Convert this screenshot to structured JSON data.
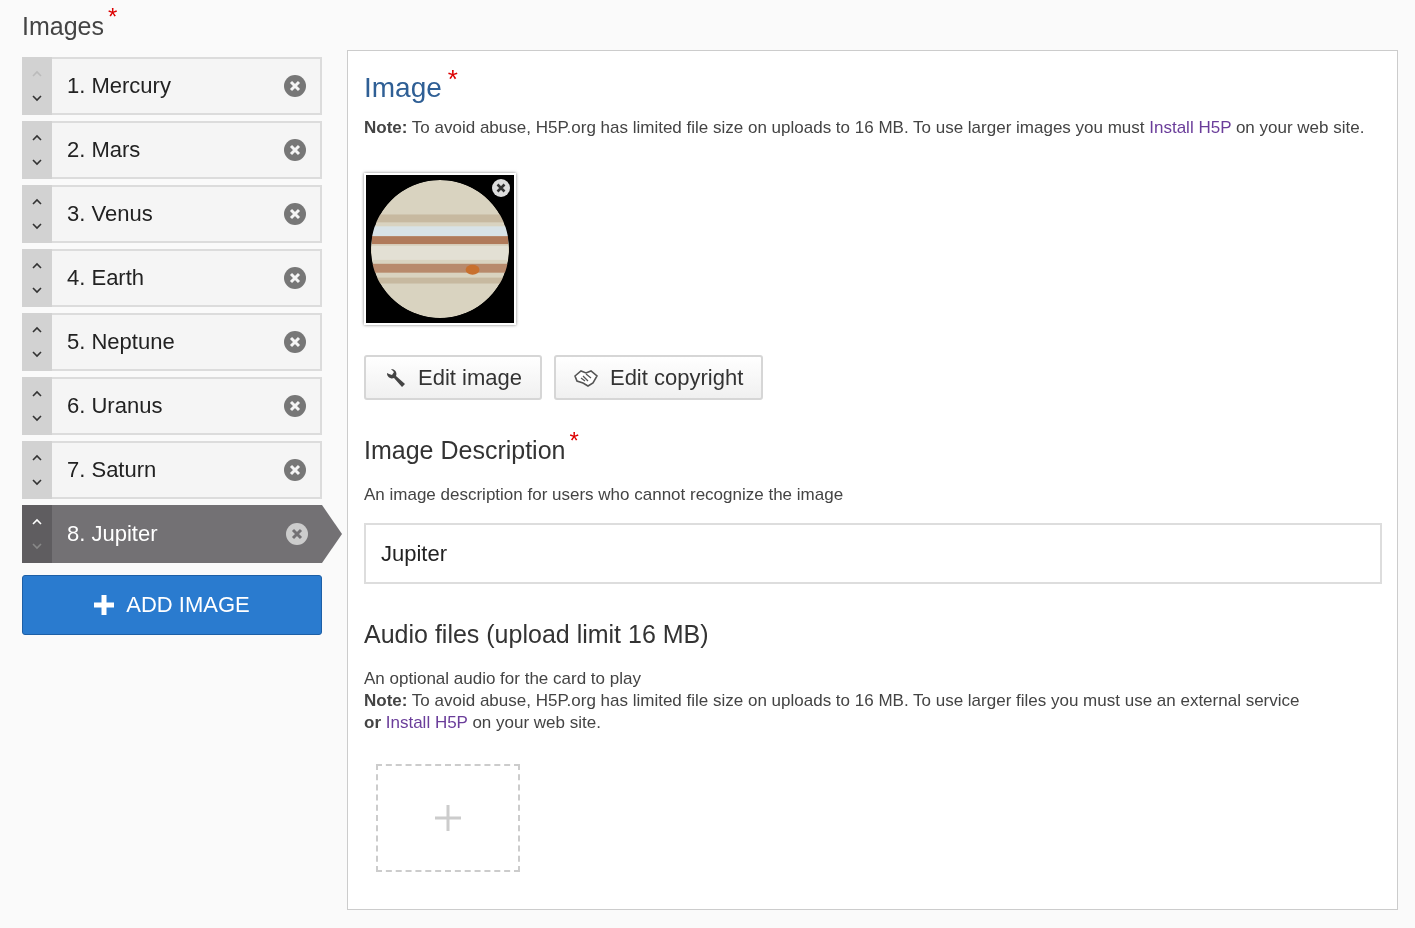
{
  "list_label": {
    "text": "Images",
    "required_marker": "*"
  },
  "items": [
    {
      "label": "1. Mercury",
      "selected": false,
      "up_disabled": true,
      "down_disabled": false
    },
    {
      "label": "2. Mars",
      "selected": false,
      "up_disabled": false,
      "down_disabled": false
    },
    {
      "label": "3. Venus",
      "selected": false,
      "up_disabled": false,
      "down_disabled": false
    },
    {
      "label": "4. Earth",
      "selected": false,
      "up_disabled": false,
      "down_disabled": false
    },
    {
      "label": "5. Neptune",
      "selected": false,
      "up_disabled": false,
      "down_disabled": false
    },
    {
      "label": "6. Uranus",
      "selected": false,
      "up_disabled": false,
      "down_disabled": false
    },
    {
      "label": "7. Saturn",
      "selected": false,
      "up_disabled": false,
      "down_disabled": false
    },
    {
      "label": "8. Jupiter",
      "selected": true,
      "up_disabled": false,
      "down_disabled": true
    }
  ],
  "add_button": {
    "label": "ADD IMAGE"
  },
  "image_field": {
    "title": "Image",
    "required_marker": "*",
    "note": [
      {
        "kind": "bold",
        "text": "Note:"
      },
      {
        "kind": "text",
        "text": " To avoid abuse, H5P.org has limited file size on uploads to 16 MB. To use larger images you must "
      },
      {
        "kind": "link",
        "text": "Install H5P"
      },
      {
        "kind": "text",
        "text": " on your web site."
      }
    ],
    "buttons": [
      {
        "kind": "edit",
        "label": "Edit image"
      },
      {
        "kind": "copyright",
        "label": "Edit copyright"
      }
    ]
  },
  "description_field": {
    "title": "Image Description",
    "required_marker": "*",
    "hint": "An image description for users who cannot recognize the image",
    "value": "Jupiter"
  },
  "audio_field": {
    "title": "Audio files (upload limit 16 MB)",
    "hint": "An optional audio for the card to play",
    "note": [
      {
        "kind": "bold",
        "text": "Note:"
      },
      {
        "kind": "text",
        "text": " To avoid abuse, H5P.org has limited file size on uploads to 16 MB. To use larger files you must use an external service "
      },
      {
        "kind": "bold",
        "text": "or"
      },
      {
        "kind": "link",
        "text": "Install H5P",
        "gap_before": true
      },
      {
        "kind": "text",
        "text": " on your web site."
      }
    ]
  }
}
